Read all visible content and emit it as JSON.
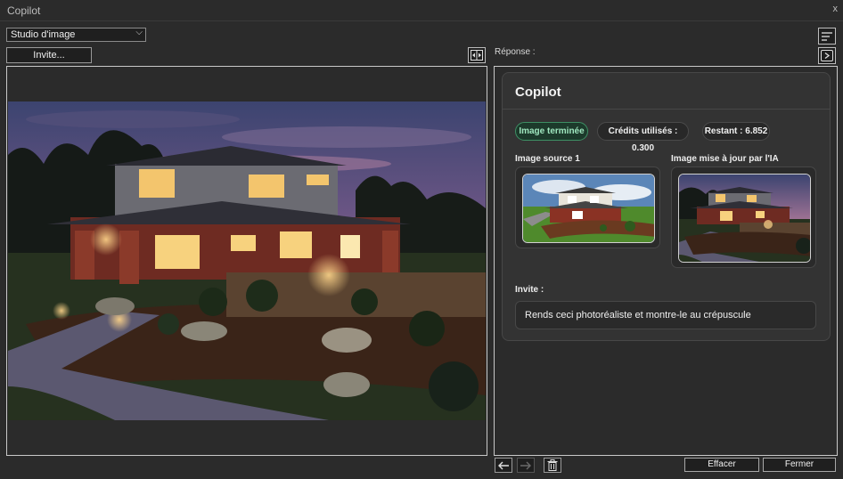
{
  "window": {
    "title": "Copilot",
    "close_glyph": "x"
  },
  "toolbar": {
    "mode_value": "Studio d'image",
    "invite_button": "Invite..."
  },
  "response": {
    "label": "Réponse :",
    "card_title": "Copilot",
    "status_badge": "Image terminée",
    "credits_used": "Crédits utilisés : 0.300",
    "remaining": "Restant : 6.852",
    "source_label": "Image source 1",
    "updated_label": "Image mise à jour par l'IA",
    "invite_label": "Invite :",
    "prompt_text": "Rends ceci photoréaliste et montre-le au crépuscule"
  },
  "footer": {
    "clear_button": "Effacer",
    "close_button": "Fermer"
  },
  "icons": {
    "compare": "compare-icon",
    "sort": "sort-lines-icon",
    "expand": "expand-panel-icon",
    "back": "arrow-left-icon",
    "forward": "arrow-right-icon",
    "trash": "trash-icon",
    "dropdown": "chevron-down-icon"
  },
  "colors": {
    "background": "#2b2b2b",
    "card": "#333333",
    "status_green": "#9fe7bf"
  }
}
